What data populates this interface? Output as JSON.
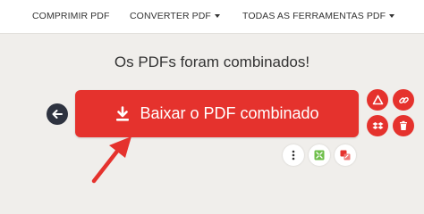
{
  "nav": {
    "compress": "COMPRIMIR PDF",
    "convert": "CONVERTER PDF",
    "all_tools": "TODAS AS FERRAMENTAS PDF"
  },
  "main": {
    "heading": "Os PDFs foram combinados!",
    "download_label": "Baixar o PDF combinado"
  },
  "colors": {
    "accent": "#e5322d",
    "dark": "#2e3340",
    "background": "#f0eeeb"
  },
  "icons": {
    "back": "arrow-left-icon",
    "download": "download-icon",
    "google_drive": "google-drive-icon",
    "share_link": "link-icon",
    "dropbox": "dropbox-icon",
    "delete": "trash-icon",
    "more": "more-vertical-icon",
    "compress_tool": "compress-pdf-icon",
    "convert_tool": "convert-pdf-icon",
    "pointer": "red-arrow-annotation"
  }
}
